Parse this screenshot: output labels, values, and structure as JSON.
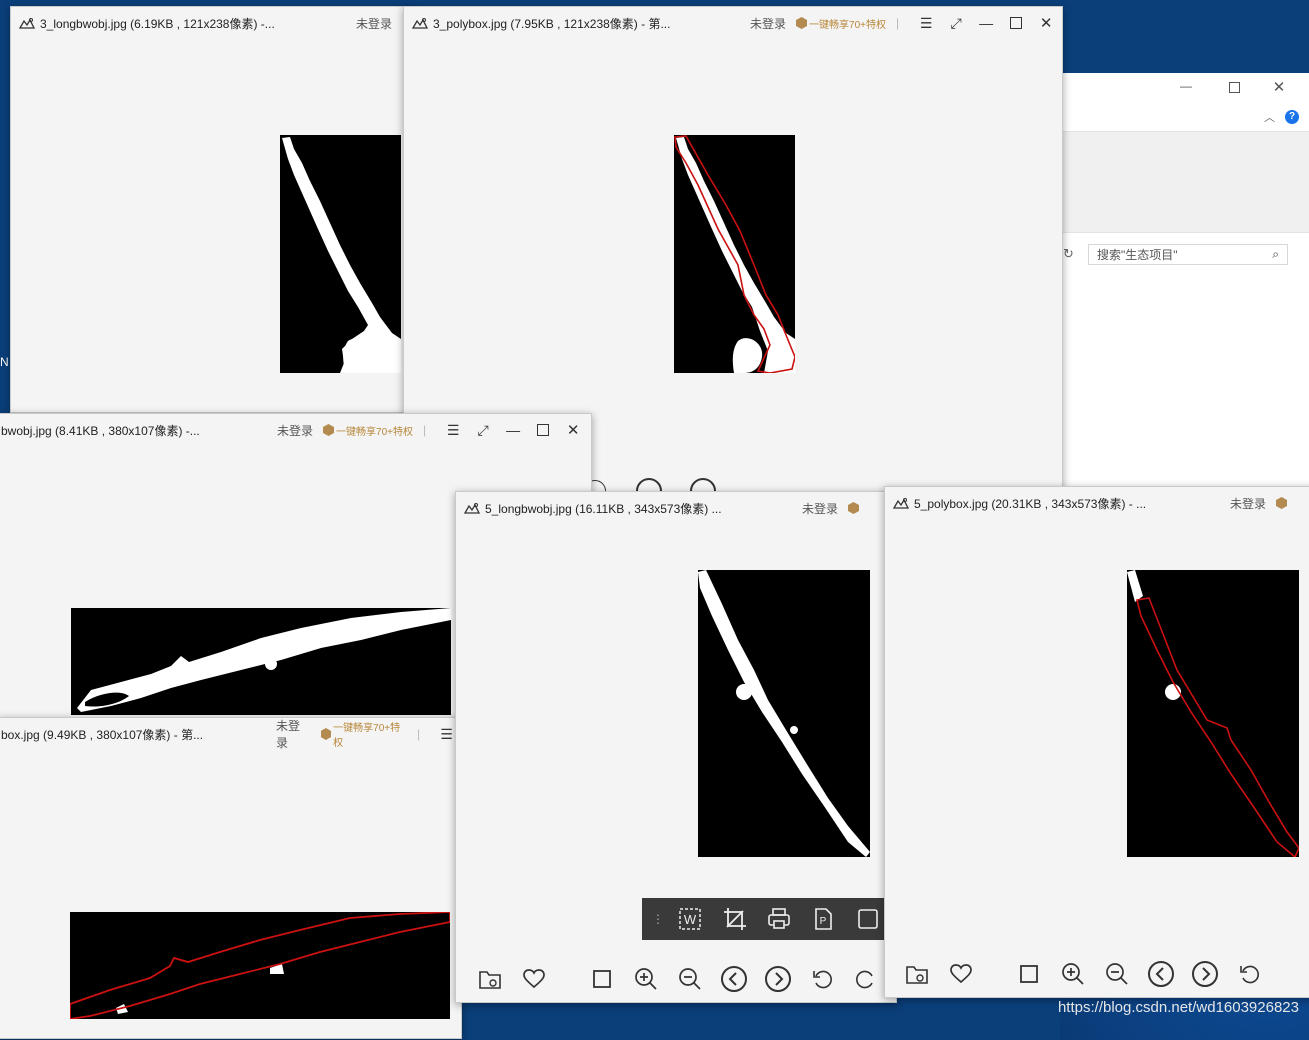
{
  "windows": {
    "w3_long": {
      "title": "3_longbwobj.jpg (6.19KB , 121x238像素) -...",
      "login": "未登录"
    },
    "w3_poly": {
      "title": "3_polybox.jpg (7.95KB , 121x238像素) - 第...",
      "login": "未登录",
      "promo": "一键畅享70+特权"
    },
    "w4_long": {
      "title": "bwobj.jpg (8.41KB , 380x107像素) -...",
      "login": "未登录",
      "promo": "一键畅享70+特权"
    },
    "w4_poly": {
      "title": "box.jpg (9.49KB , 380x107像素) - 第...",
      "login": "未登录",
      "promo": "一键畅享70+特权"
    },
    "w5_long": {
      "title": "5_longbwobj.jpg (16.11KB , 343x573像素) ...",
      "login": "未登录"
    },
    "w5_poly": {
      "title": "5_polybox.jpg (20.31KB , 343x573像素) - ...",
      "login": "未登录"
    }
  },
  "explorer": {
    "search_placeholder": "搜索\"生态项目\""
  },
  "desktop": {
    "edge_letter": "N"
  },
  "watermark": "https://blog.csdn.net/wd1603926823",
  "colors": {
    "accent_promo": "#b8873a",
    "contour": "#cc1111",
    "help": "#1a73e8"
  }
}
